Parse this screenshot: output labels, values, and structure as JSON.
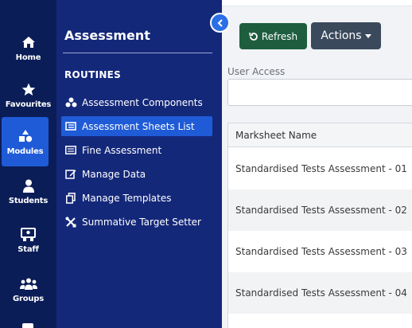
{
  "rail": {
    "items": [
      {
        "label": "Home",
        "icon": "home-icon"
      },
      {
        "label": "Favourites",
        "icon": "star-icon"
      },
      {
        "label": "Modules",
        "icon": "modules-icon",
        "active": true
      },
      {
        "label": "Students",
        "icon": "person-icon"
      },
      {
        "label": "Staff",
        "icon": "staff-icon"
      },
      {
        "label": "Groups",
        "icon": "group-icon"
      }
    ]
  },
  "panel": {
    "title": "Assessment",
    "section": "ROUTINES",
    "items": [
      {
        "label": "Assessment Components",
        "icon": "components-icon"
      },
      {
        "label": "Assessment Sheets List",
        "icon": "sheets-list-icon",
        "active": true
      },
      {
        "label": "Fine Assessment",
        "icon": "list-icon"
      },
      {
        "label": "Manage Data",
        "icon": "edit-icon"
      },
      {
        "label": "Manage Templates",
        "icon": "copy-icon"
      },
      {
        "label": "Summative Target Setter",
        "icon": "tools-icon"
      }
    ]
  },
  "toolbar": {
    "refresh_label": "Refresh",
    "actions_label": "Actions",
    "refresh_color": "#1e5e3f",
    "actions_color": "#3a4a5c"
  },
  "filter": {
    "label": "User Access",
    "value": ""
  },
  "table": {
    "header": "Marksheet Name",
    "rows": [
      "Standardised Tests Assessment - 01",
      "Standardised Tests Assessment - 02",
      "Standardised Tests Assessment - 03",
      "Standardised Tests Assessment - 04"
    ]
  },
  "colors": {
    "rail_bg": "#0b1d57",
    "panel_bg": "#14287a",
    "active_bg": "#1f5bd6"
  }
}
